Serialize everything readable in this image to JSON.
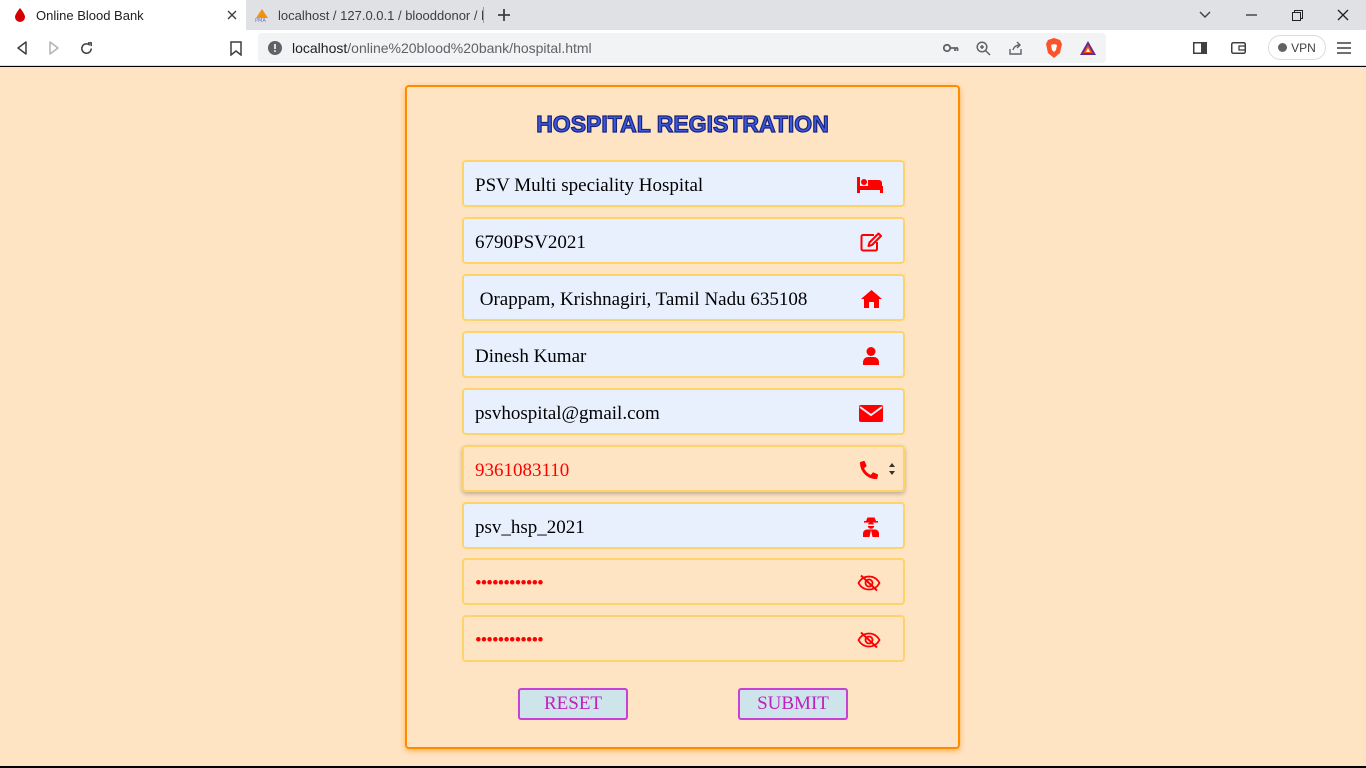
{
  "browser": {
    "tabs": [
      {
        "title": "Online Blood Bank",
        "active": true,
        "favicon": "blood-drop-icon"
      },
      {
        "title": "localhost / 127.0.0.1 / blooddonor / bl",
        "active": false,
        "favicon": "phpmyadmin-icon"
      }
    ],
    "url_host": "localhost",
    "url_path": "/online%20blood%20bank/hospital.html",
    "vpn_label": "VPN"
  },
  "page": {
    "title": "HOSPITAL REGISTRATION",
    "fields": [
      {
        "value": "PSV Multi speciality Hospital",
        "icon": "bed-icon"
      },
      {
        "value": "6790PSV2021",
        "icon": "edit-icon"
      },
      {
        "value": " Orappam, Krishnagiri, Tamil Nadu 635108",
        "icon": "home-icon"
      },
      {
        "value": "Dinesh Kumar",
        "icon": "user-icon"
      },
      {
        "value": "psvhospital@gmail.com",
        "icon": "envelope-icon"
      },
      {
        "value": "9361083110",
        "icon": "phone-icon"
      },
      {
        "value": "psv_hsp_2021",
        "icon": "user-secret-icon"
      },
      {
        "value": "••••••••••••",
        "icon": "eye-slash-icon"
      },
      {
        "value": "••••••••••••",
        "icon": "eye-slash-icon"
      }
    ],
    "reset_label": "RESET",
    "submit_label": "SUBMIT"
  },
  "colors": {
    "page_bg": "#ffe4c4",
    "card_border": "#ff8c00",
    "icon_red": "#ff0000",
    "title_blue": "#3b5bdb",
    "button_text": "#c020c0"
  }
}
